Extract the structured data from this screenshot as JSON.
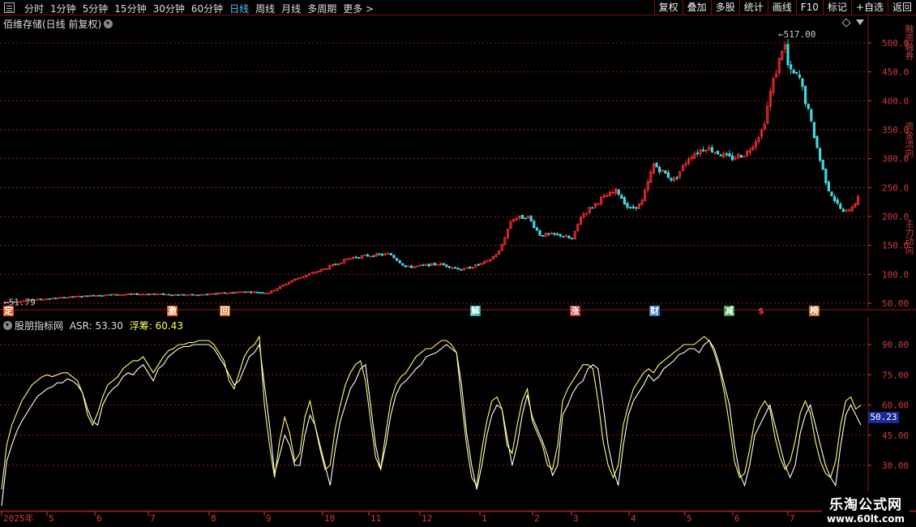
{
  "toolbar": {
    "tabs": [
      {
        "label": "分时"
      },
      {
        "label": "1分钟"
      },
      {
        "label": "5分钟"
      },
      {
        "label": "15分钟"
      },
      {
        "label": "30分钟"
      },
      {
        "label": "60分钟"
      },
      {
        "label": "日线",
        "active": true
      },
      {
        "label": "周线"
      },
      {
        "label": "月线"
      },
      {
        "label": "多周期"
      },
      {
        "label": "更多 >"
      }
    ],
    "right": [
      {
        "label": "复权"
      },
      {
        "label": "叠加"
      },
      {
        "label": "多股"
      },
      {
        "label": "统计"
      },
      {
        "label": "画线"
      },
      {
        "label": "F10"
      },
      {
        "label": "标记"
      },
      {
        "label": "+自选"
      },
      {
        "label": "返回"
      }
    ]
  },
  "price_pane": {
    "title": "佰维存储(日线 前复权)",
    "high_label": "517.00",
    "low_label": "51.79",
    "axis_ticks": [
      "500.0",
      "450.0",
      "400.0",
      "350.0",
      "300.0",
      "250.0",
      "200.0",
      "150.0",
      "100.0",
      "50.00"
    ],
    "events": [
      {
        "label": "定",
        "color": "#e05a1a"
      },
      {
        "label": "激",
        "color": "#e05a1a"
      },
      {
        "label": "回",
        "color": "#c86a20"
      },
      {
        "label": "解",
        "color": "#2aa8a8"
      },
      {
        "label": "涨",
        "color": "#c0292b"
      },
      {
        "label": "财",
        "color": "#2a72c0"
      },
      {
        "label": "减",
        "color": "#2e9a44"
      },
      {
        "label": "$",
        "color": "#c0292b"
      },
      {
        "label": "榜",
        "color": "#c86a20"
      }
    ]
  },
  "indicator_pane": {
    "name": "股朋指标网",
    "asr_label": "ASR:",
    "asr_value": "53.30",
    "float_label": "浮筹:",
    "float_value": "60.43",
    "current_value": "50.23",
    "axis_ticks": [
      "90.00",
      "75.00",
      "60.00",
      "45.00",
      "30.00"
    ]
  },
  "x_axis": {
    "labels": [
      "2025年",
      "5",
      "6",
      "7",
      "8",
      "9",
      "10",
      "11",
      "12",
      "1",
      "2",
      "3",
      "4",
      "5",
      "6",
      "7"
    ]
  },
  "watermark": {
    "name": "乐淘公式网",
    "url": "www.60lt.com"
  },
  "colors": {
    "up": "#ff3030",
    "down": "#40d8e0",
    "grid": "#8a1a1a",
    "asr": "#ffffff",
    "float": "#ffff66"
  },
  "chart_data": {
    "type": "line",
    "series": [
      {
        "name": "ASR",
        "values": [
          10,
          32,
          40,
          47,
          52,
          56,
          60,
          64,
          66,
          68,
          69,
          71,
          71,
          73,
          72,
          70,
          66,
          58,
          52,
          50,
          60,
          65,
          68,
          70,
          74,
          76,
          75,
          78,
          80,
          76,
          72,
          78,
          80,
          84,
          86,
          88,
          89,
          89,
          90,
          90,
          90,
          90,
          88,
          84,
          80,
          75,
          70,
          72,
          78,
          84,
          86,
          90,
          70,
          50,
          26,
          35,
          45,
          40,
          30,
          30,
          45,
          55,
          50,
          40,
          30,
          20,
          38,
          52,
          60,
          68,
          72,
          78,
          80,
          60,
          40,
          28,
          40,
          55,
          65,
          70,
          72,
          75,
          78,
          80,
          84,
          85,
          86,
          88,
          90,
          88,
          86,
          70,
          46,
          30,
          18,
          30,
          45,
          55,
          60,
          58,
          44,
          30,
          40,
          55,
          65,
          54,
          48,
          42,
          35,
          25,
          30,
          55,
          60,
          66,
          70,
          72,
          78,
          80,
          78,
          60,
          40,
          28,
          20,
          40,
          55,
          62,
          66,
          70,
          75,
          72,
          74,
          78,
          80,
          82,
          85,
          86,
          88,
          88,
          86,
          90,
          92,
          88,
          80,
          70,
          60,
          40,
          26,
          20,
          30,
          45,
          50,
          55,
          60,
          50,
          40,
          30,
          24,
          30,
          46,
          55,
          60,
          50,
          40,
          30,
          24,
          20,
          40,
          55,
          60,
          55,
          50
        ]
      },
      {
        "name": "浮筹",
        "values": [
          18,
          40,
          50,
          56,
          62,
          66,
          70,
          72,
          74,
          75,
          74,
          75,
          76,
          76,
          74,
          72,
          66,
          55,
          50,
          56,
          64,
          70,
          72,
          74,
          78,
          80,
          82,
          82,
          84,
          80,
          76,
          80,
          84,
          87,
          88,
          90,
          90,
          91,
          91,
          92,
          92,
          92,
          90,
          86,
          82,
          72,
          68,
          76,
          84,
          88,
          90,
          94,
          60,
          40,
          24,
          42,
          54,
          46,
          32,
          36,
          54,
          62,
          50,
          38,
          28,
          30,
          48,
          60,
          70,
          76,
          80,
          82,
          72,
          52,
          34,
          28,
          46,
          62,
          70,
          74,
          76,
          80,
          84,
          86,
          88,
          88,
          90,
          92,
          92,
          90,
          86,
          62,
          40,
          24,
          20,
          38,
          52,
          62,
          64,
          58,
          40,
          36,
          50,
          62,
          68,
          52,
          46,
          40,
          30,
          28,
          40,
          62,
          68,
          72,
          76,
          80,
          80,
          78,
          62,
          42,
          30,
          24,
          30,
          50,
          60,
          68,
          72,
          76,
          78,
          76,
          80,
          82,
          84,
          86,
          88,
          90,
          90,
          90,
          92,
          94,
          92,
          86,
          78,
          66,
          50,
          32,
          24,
          26,
          38,
          52,
          58,
          62,
          58,
          44,
          34,
          28,
          32,
          42,
          56,
          62,
          56,
          42,
          32,
          26,
          24,
          32,
          50,
          62,
          64,
          58,
          60
        ]
      }
    ]
  }
}
